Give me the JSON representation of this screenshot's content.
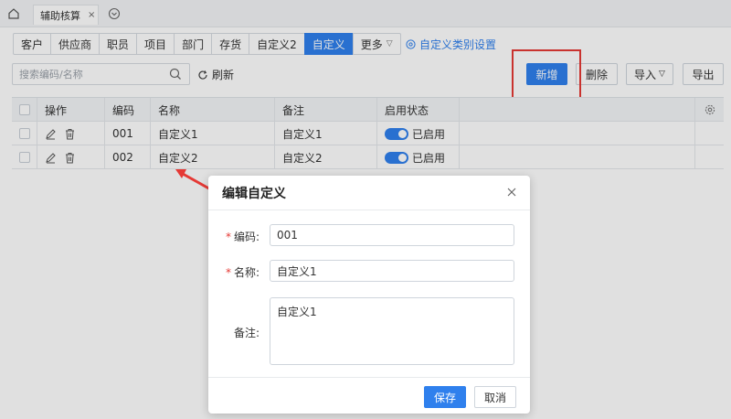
{
  "top_tab": {
    "label": "辅助核算",
    "close": "×"
  },
  "category_tabs": [
    {
      "label": "客户",
      "active": false
    },
    {
      "label": "供应商",
      "active": false
    },
    {
      "label": "职员",
      "active": false
    },
    {
      "label": "项目",
      "active": false
    },
    {
      "label": "部门",
      "active": false
    },
    {
      "label": "存货",
      "active": false
    },
    {
      "label": "自定义2",
      "active": false
    },
    {
      "label": "自定义",
      "active": true
    }
  ],
  "more_tab": {
    "label": "更多"
  },
  "category_setting": {
    "label": "自定义类别设置"
  },
  "search": {
    "placeholder": "搜索编码/名称",
    "value": ""
  },
  "refresh": {
    "label": "刷新"
  },
  "toolbar": {
    "add": "新增",
    "delete": "删除",
    "import": "导入",
    "export": "导出"
  },
  "table": {
    "headers": {
      "op": "操作",
      "code": "编码",
      "name": "名称",
      "note": "备注",
      "status": "启用状态"
    },
    "rows": [
      {
        "code": "001",
        "name": "自定义1",
        "note": "自定义1",
        "status": "已启用"
      },
      {
        "code": "002",
        "name": "自定义2",
        "note": "自定义2",
        "status": "已启用"
      }
    ]
  },
  "modal": {
    "title": "编辑自定义",
    "fields": {
      "code_label": "编码:",
      "code_value": "001",
      "name_label": "名称:",
      "name_value": "自定义1",
      "note_label": "备注:",
      "note_value": "自定义1"
    },
    "required_mark": "*",
    "save": "保存",
    "cancel": "取消"
  },
  "colors": {
    "accent": "#2f80ed",
    "highlight": "#e53935"
  }
}
